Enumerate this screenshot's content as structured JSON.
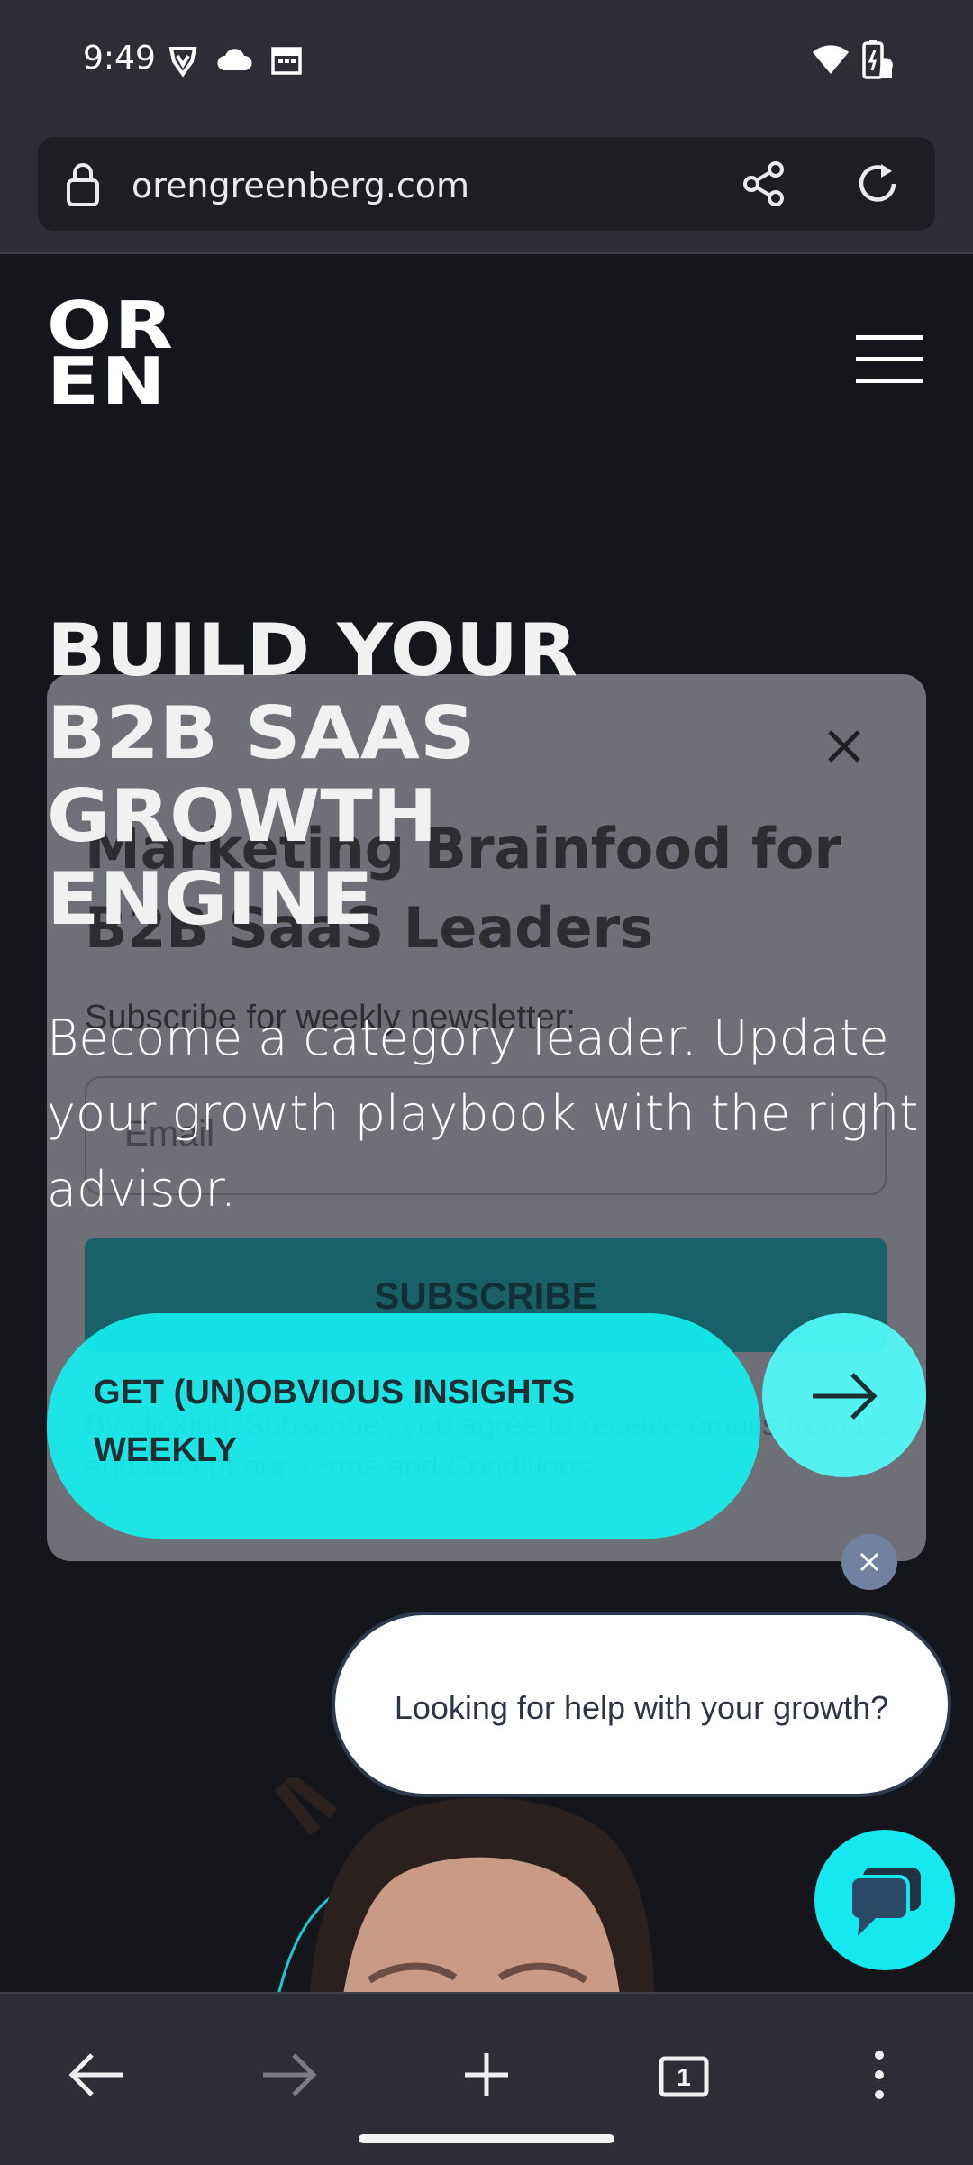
{
  "status_bar": {
    "time": "9:49",
    "left_icons": [
      "brave-icon",
      "cloud-icon",
      "calendar-icon"
    ],
    "right_icons": [
      "wifi-icon",
      "battery-charging-icon"
    ]
  },
  "browser": {
    "url": "orengreenberg.com",
    "icons": [
      "lock-icon",
      "share-icon",
      "reload-icon"
    ]
  },
  "site": {
    "logo_line1": "OR",
    "logo_line2": "EN",
    "hero_title_lines": [
      "BUILD YOUR",
      "B2B SAAS",
      "GROWTH",
      "ENGINE"
    ],
    "hero_subtitle": "Become a category leader. Update your growth playbook with the right advisor.",
    "cta_label": "GET (UN)OBVIOUS INSIGHTS WEEKLY"
  },
  "popup": {
    "title": "Marketing Brainfood for B2B SaaS Leaders",
    "subtitle": "Subscribe for weekly newsletter:",
    "email_placeholder": "Email",
    "subscribe_label": "SUBSCRIBE",
    "terms": "By clicking 'Subscribe', you agree to receive emails from us and accept our Terms and Conditions."
  },
  "chat": {
    "bubble_text": "Looking for help with your growth?"
  },
  "colors": {
    "accent": "#13f5f5",
    "background": "#15161c",
    "chrome": "#2c2d35"
  }
}
